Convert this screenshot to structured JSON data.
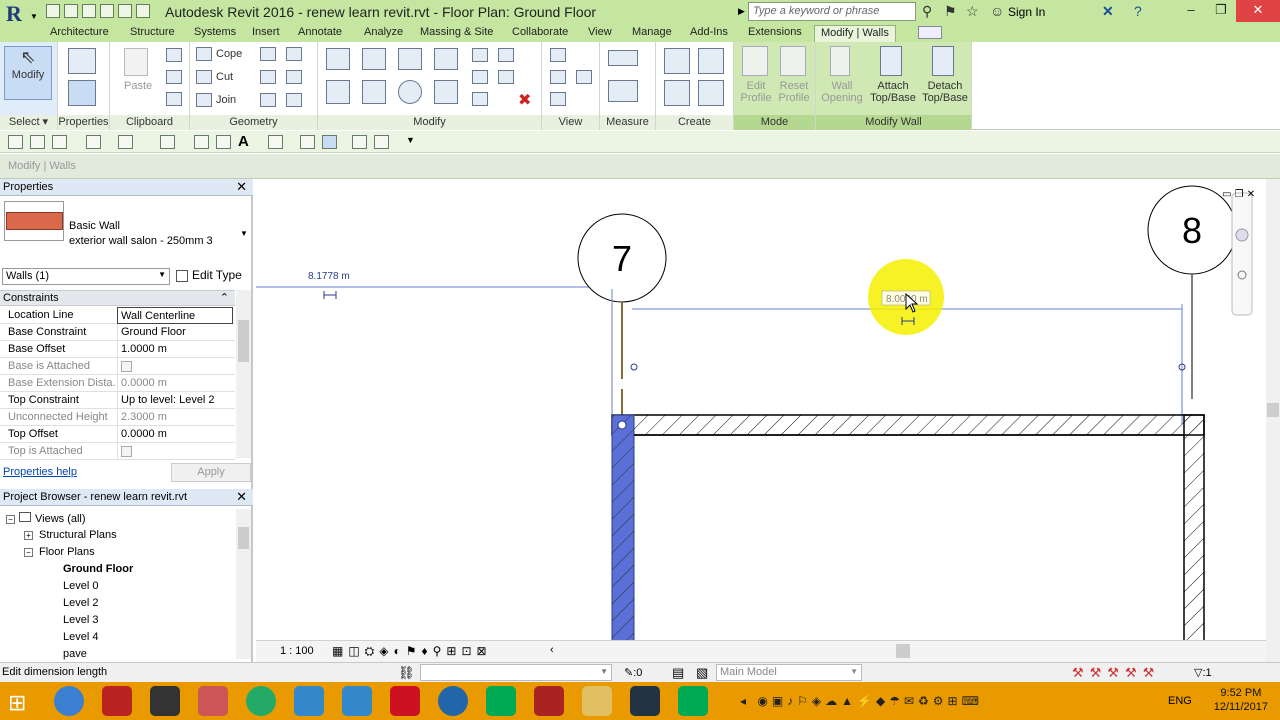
{
  "app": {
    "title": "Autodesk Revit 2016 -     renew learn revit.rvt - Floor Plan: Ground Floor",
    "search_placeholder": "Type a keyword or phrase",
    "sign_in": "Sign In"
  },
  "tabs": [
    "Architecture",
    "Structure",
    "Systems",
    "Insert",
    "Annotate",
    "Analyze",
    "Massing & Site",
    "Collaborate",
    "View",
    "Manage",
    "Add-Ins",
    "Extensions",
    "Modify | Walls"
  ],
  "ribbon": {
    "modify_label": "Modify",
    "select_label": "Select",
    "properties_label": "Properties",
    "paste_label": "Paste",
    "clipboard_label": "Clipboard",
    "cope_label": "Cope",
    "cut_label": "Cut",
    "join_label": "Join",
    "geometry_label": "Geometry",
    "modify_panel_label": "Modify",
    "view_label": "View",
    "measure_label": "Measure",
    "create_label": "Create",
    "edit_profile": "Edit Profile",
    "reset_profile": "Reset Profile",
    "mode_label": "Mode",
    "wall_opening": "Wall Opening",
    "attach_top": "Attach Top/Base",
    "detach_top": "Detach Top/Base",
    "modify_wall_label": "Modify Wall"
  },
  "context_bar": "Modify | Walls",
  "properties": {
    "header": "Properties",
    "type_line1": "Basic Wall",
    "type_line2": "exterior wall salon  - 250mm 3",
    "selector": "Walls (1)",
    "edit_type": "Edit Type",
    "section": "Constraints",
    "rows": [
      {
        "k": "Location Line",
        "v": "Wall Centerline"
      },
      {
        "k": "Base Constraint",
        "v": "Ground Floor"
      },
      {
        "k": "Base Offset",
        "v": "1.0000 m"
      },
      {
        "k": "Base is Attached",
        "v": ""
      },
      {
        "k": "Base Extension Dista...",
        "v": "0.0000 m"
      },
      {
        "k": "Top Constraint",
        "v": "Up to level: Level 2"
      },
      {
        "k": "Unconnected Height",
        "v": "2.3000 m"
      },
      {
        "k": "Top Offset",
        "v": "0.0000 m"
      },
      {
        "k": "Top is Attached",
        "v": ""
      }
    ],
    "help": "Properties help",
    "apply": "Apply"
  },
  "browser": {
    "header": "Project Browser - renew learn revit.rvt",
    "items": [
      "Views (all)",
      "Structural Plans",
      "Floor Plans",
      "Ground Floor",
      "Level 0",
      "Level 2",
      "Level 3",
      "Level 4",
      "pave"
    ]
  },
  "canvas": {
    "grid_7": "7",
    "grid_8": "8",
    "dim_left": "8.1778 m",
    "dim_edit": "8.0000 m"
  },
  "view_bar": {
    "scale": "1 : 100"
  },
  "status": {
    "text": "Edit dimension length",
    "zero": ":0",
    "model": "Main Model",
    "filter": ":1"
  },
  "taskbar": {
    "time": "9:52 PM",
    "date": "12/11/2017",
    "lang": "ENG"
  },
  "colors": {
    "ribbon_green": "#c4e6a0",
    "wall_selected": "#5b6fd6",
    "taskbar": "#e89a00",
    "highlight": "#f6f000"
  }
}
